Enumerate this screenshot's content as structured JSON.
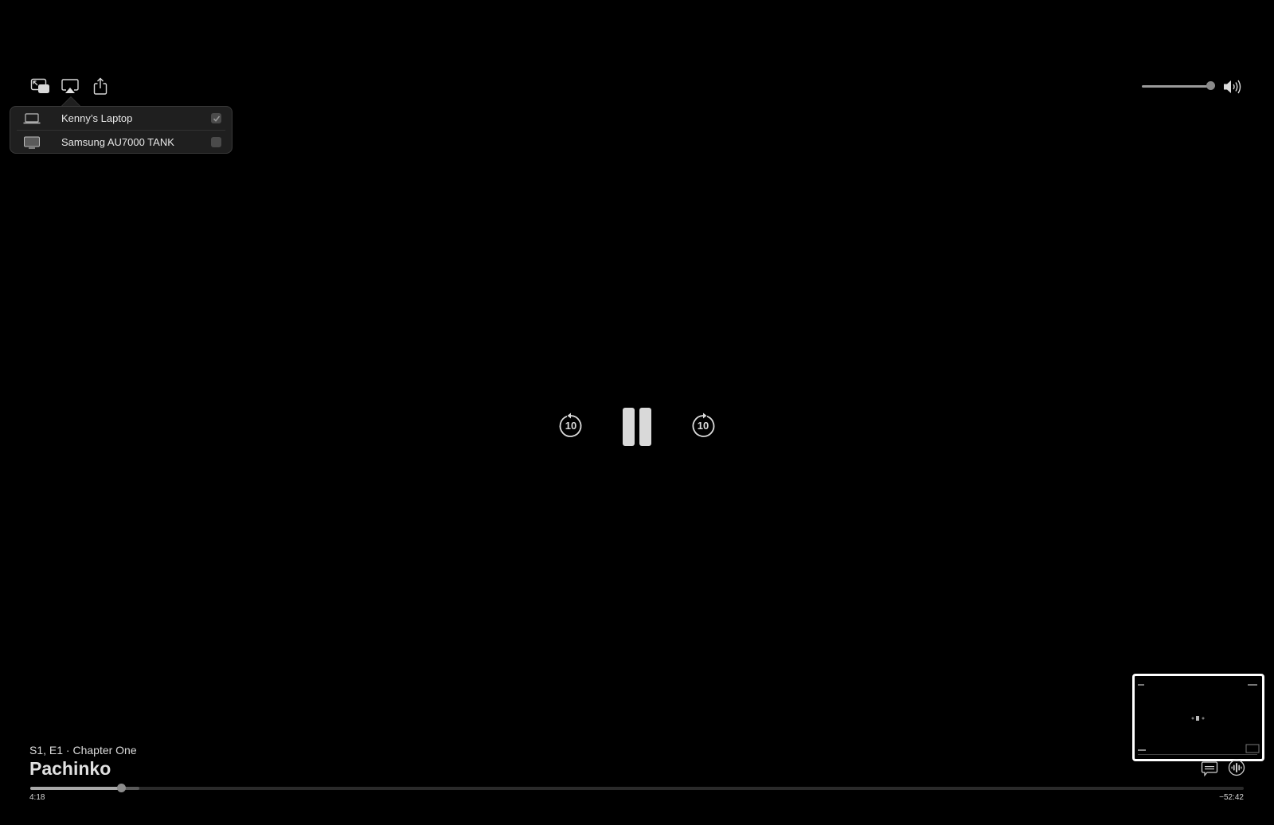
{
  "toolbar": {
    "pip_icon": "picture-in-picture-icon",
    "airplay_icon": "airplay-icon",
    "share_icon": "share-icon"
  },
  "airplay_menu": {
    "devices": [
      {
        "label": "Kenny’s Laptop",
        "icon": "laptop-icon",
        "checked": true
      },
      {
        "label": "Samsung AU7000 TANK",
        "icon": "tv-icon",
        "checked": false
      }
    ]
  },
  "volume": {
    "level_percent": 100,
    "icon": "speaker-volume-icon"
  },
  "controls": {
    "skip_back_label": "10",
    "skip_forward_label": "10",
    "state": "playing"
  },
  "media": {
    "episode": "S1, E1 · Chapter One",
    "title": "Pachinko",
    "elapsed": "4:18",
    "remaining": "−52:42",
    "progress_percent": 7.5,
    "buffered_percent": 9.0
  },
  "bottom_right": {
    "subtitles_icon": "subtitles-icon",
    "audio_icon": "audio-tracks-icon"
  }
}
